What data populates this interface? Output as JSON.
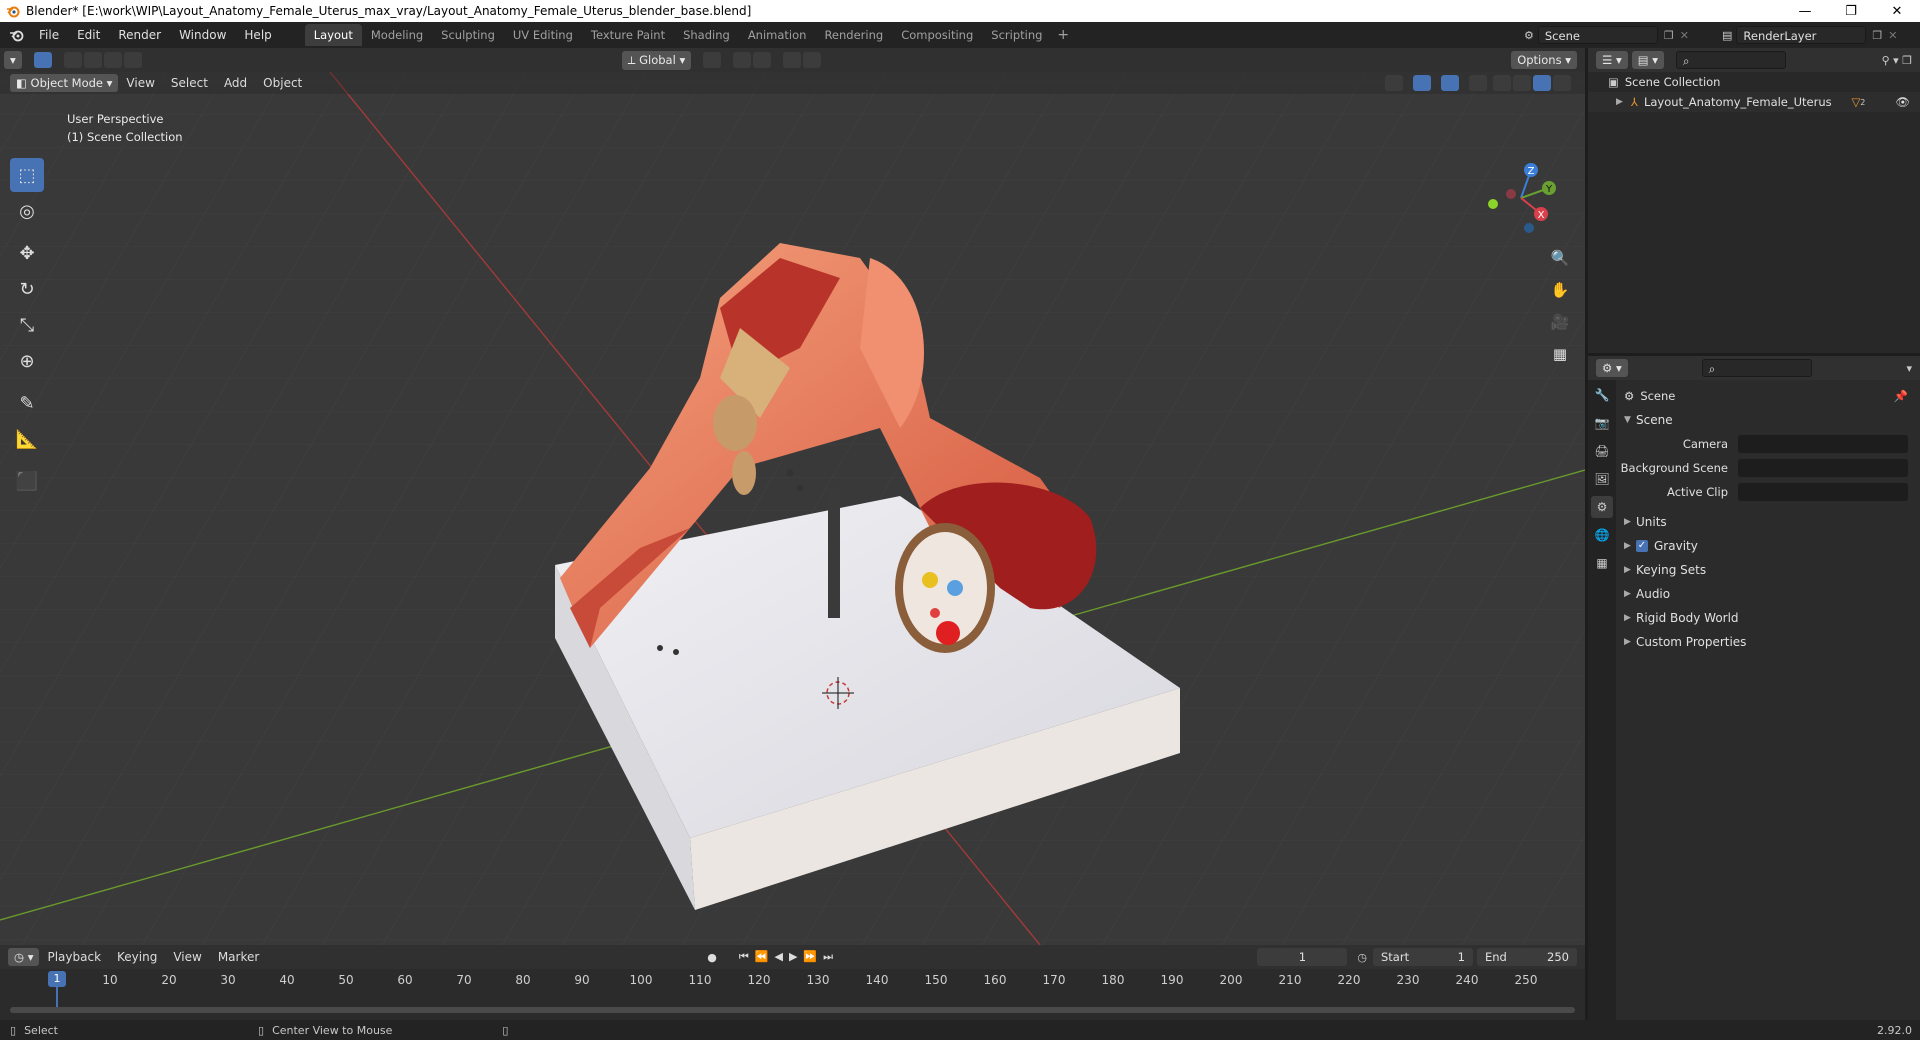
{
  "window": {
    "title": "Blender* [E:\\work\\WIP\\Layout_Anatomy_Female_Uterus_max_vray/Layout_Anatomy_Female_Uterus_blender_base.blend]",
    "minimize": "—",
    "restore": "❐",
    "close": "✕"
  },
  "menu": [
    "File",
    "Edit",
    "Render",
    "Window",
    "Help"
  ],
  "workspaces": [
    "Layout",
    "Modeling",
    "Sculpting",
    "UV Editing",
    "Texture Paint",
    "Shading",
    "Animation",
    "Rendering",
    "Compositing",
    "Scripting"
  ],
  "workspace_add": "+",
  "scene_name": "Scene",
  "render_layer": "RenderLayer",
  "viewport_header": {
    "transform_orientation": "Global",
    "options": "Options"
  },
  "viewport_header2": {
    "mode": "Object Mode",
    "menus": [
      "View",
      "Select",
      "Add",
      "Object"
    ]
  },
  "viewport_info": {
    "perspective": "User Perspective",
    "collection": "(1) Scene Collection"
  },
  "gizmo": {
    "x": "X",
    "y": "Y",
    "z": "Z"
  },
  "timeline": {
    "menus": [
      "Playback",
      "Keying",
      "View",
      "Marker"
    ],
    "current_frame": "1",
    "start_label": "Start",
    "start": "1",
    "end_label": "End",
    "end": "250",
    "cursor_frame": "1",
    "ticks": [
      "10",
      "20",
      "30",
      "40",
      "50",
      "60",
      "70",
      "80",
      "90",
      "100",
      "110",
      "120",
      "130",
      "140",
      "150",
      "160",
      "170",
      "180",
      "190",
      "200",
      "210",
      "220",
      "230",
      "240",
      "250"
    ]
  },
  "status": {
    "select": "Select",
    "center_view": "Center View to Mouse",
    "version": "2.92.0"
  },
  "outliner": {
    "root": "Scene Collection",
    "items": [
      "Layout_Anatomy_Female_Uterus"
    ],
    "item_badge": "2"
  },
  "properties": {
    "context": "Scene",
    "section": "Scene",
    "fields": [
      {
        "label": "Camera"
      },
      {
        "label": "Background Scene"
      },
      {
        "label": "Active Clip"
      }
    ],
    "panels": [
      "Units",
      "Gravity",
      "Keying Sets",
      "Audio",
      "Rigid Body World",
      "Custom Properties"
    ]
  },
  "colors": {
    "accent": "#4772b3",
    "viewport_bg": "#393939",
    "grid_x_axis": "#a13a3a",
    "grid_y_axis": "#6a9a2c"
  }
}
